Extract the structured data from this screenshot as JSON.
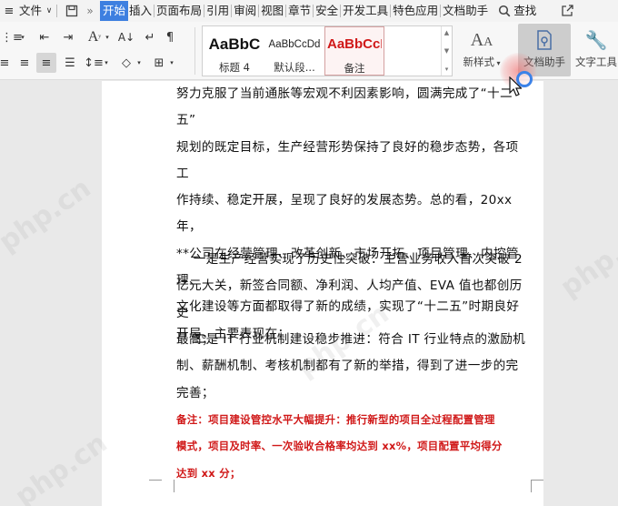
{
  "menubar": {
    "file_label": "文件",
    "tabs": [
      "开始",
      "插入",
      "页面布局",
      "引用",
      "审阅",
      "视图",
      "章节",
      "安全",
      "开发工具",
      "特色应用",
      "文档助手"
    ],
    "active_tab": "开始",
    "search_label": "查找"
  },
  "ribbon": {
    "styles": [
      {
        "sample": "AaBbC",
        "name": "标题 4"
      },
      {
        "sample": "AaBbCcDd",
        "name": "默认段..."
      },
      {
        "sample": "AaBbCcI",
        "name": "备注"
      }
    ],
    "new_style_label": "新样式",
    "doc_assistant_label": "文档助手",
    "text_tools_label": "文字工具"
  },
  "document": {
    "paragraphs": [
      {
        "lines": [
          "努力克服了当前通胀等宏观不利因素影响，圆满完成了“十二五”",
          "规划的既定目标，生产经营形势保持了良好的稳步态势，各项工",
          "作持续、稳定开展，呈现了良好的发展态势。总的看，20xx 年，",
          "**公司在经营管理、改革创新、市场开拓、项目管理、内控管理、",
          "文化建设等方面都取得了新的成绩，实现了“十二五”时期良好",
          "开局。主要表现在："
        ]
      },
      {
        "lines": [
          "    一是生产经营实现了历史性突破：主营业务收入首次突破 2",
          "亿元大关，新签合同额、净利润、人均产值、EVA 值也都创历史",
          "最高；"
        ]
      },
      {
        "lines": [
          "    二是 IT 行业机制建设稳步推进：符合 IT 行业特点的激励机",
          "制、薪酬机制、考核机制都有了新的举措，得到了进一步的完",
          "完善；"
        ]
      }
    ],
    "note_lines": [
      "备注：项目建设管控水平大幅提升：推行新型的项目全过程配置管理",
      "模式，项目及时率、一次验收合格率均达到 xx%，项目配置平均得分",
      "达到 xx 分；"
    ]
  },
  "watermark": "php.cn",
  "colors": {
    "accent": "#3d7fe0",
    "note_red": "#d01818"
  }
}
